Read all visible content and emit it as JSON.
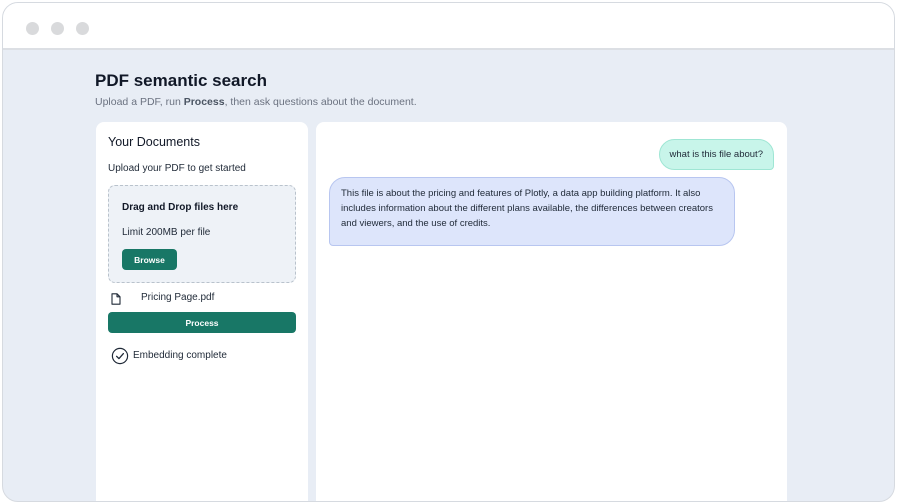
{
  "app": {
    "title": "PDF semantic search",
    "subtitle_prefix": "Upload a PDF, run ",
    "subtitle_bold": "Process",
    "subtitle_suffix": ", then ask questions about the document."
  },
  "sidebar": {
    "title": "Your Documents",
    "help_text": "Upload your PDF to get started",
    "dropzone": {
      "title": "Drag and Drop files here",
      "limit": "Limit 200MB per file",
      "browse_label": "Browse"
    },
    "file": {
      "icon": "file-icon",
      "name": "Pricing Page.pdf"
    },
    "process_label": "Process",
    "status": {
      "icon": "check-circle-icon",
      "text": "Embedding complete"
    }
  },
  "chat": {
    "messages": [
      {
        "role": "user",
        "text": "what is this file about?"
      },
      {
        "role": "assistant",
        "text": "This file is about the pricing and features of Plotly, a data app building platform. It also includes information about the different plans available, the differences between creators and viewers, and the use of credits."
      }
    ]
  },
  "colors": {
    "accent": "#187766",
    "user_bubble": "#c8f5ea",
    "assistant_bubble": "#dde5fb",
    "page_background": "#e8edf5"
  }
}
